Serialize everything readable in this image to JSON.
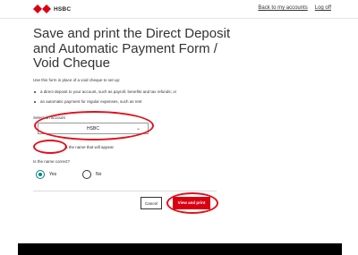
{
  "header": {
    "brand": "HSBC",
    "links": [
      "Back to my accounts",
      "Log off"
    ]
  },
  "form": {
    "title": "Save and print the Direct Deposit and Automatic Payment Form / Void Cheque",
    "intro": "Use this form in place of a void cheque to set up:",
    "bullets": [
      "a direct deposit to your account, such as payroll, benefits and tax refunds; or",
      "an automatic payment for regular expenses, such as rent"
    ],
    "select_label": "Select an account",
    "select_value": "HSBC",
    "name_line_suffix": "is the name that will appear",
    "question": "Is the name correct?",
    "options": {
      "yes": "Yes",
      "no": "No"
    },
    "cancel_label": "Cancel",
    "submit_label": "View and print"
  },
  "colors": {
    "brand_red": "#db0011",
    "radio_selected": "#00847f",
    "annotation": "#e0101c"
  }
}
